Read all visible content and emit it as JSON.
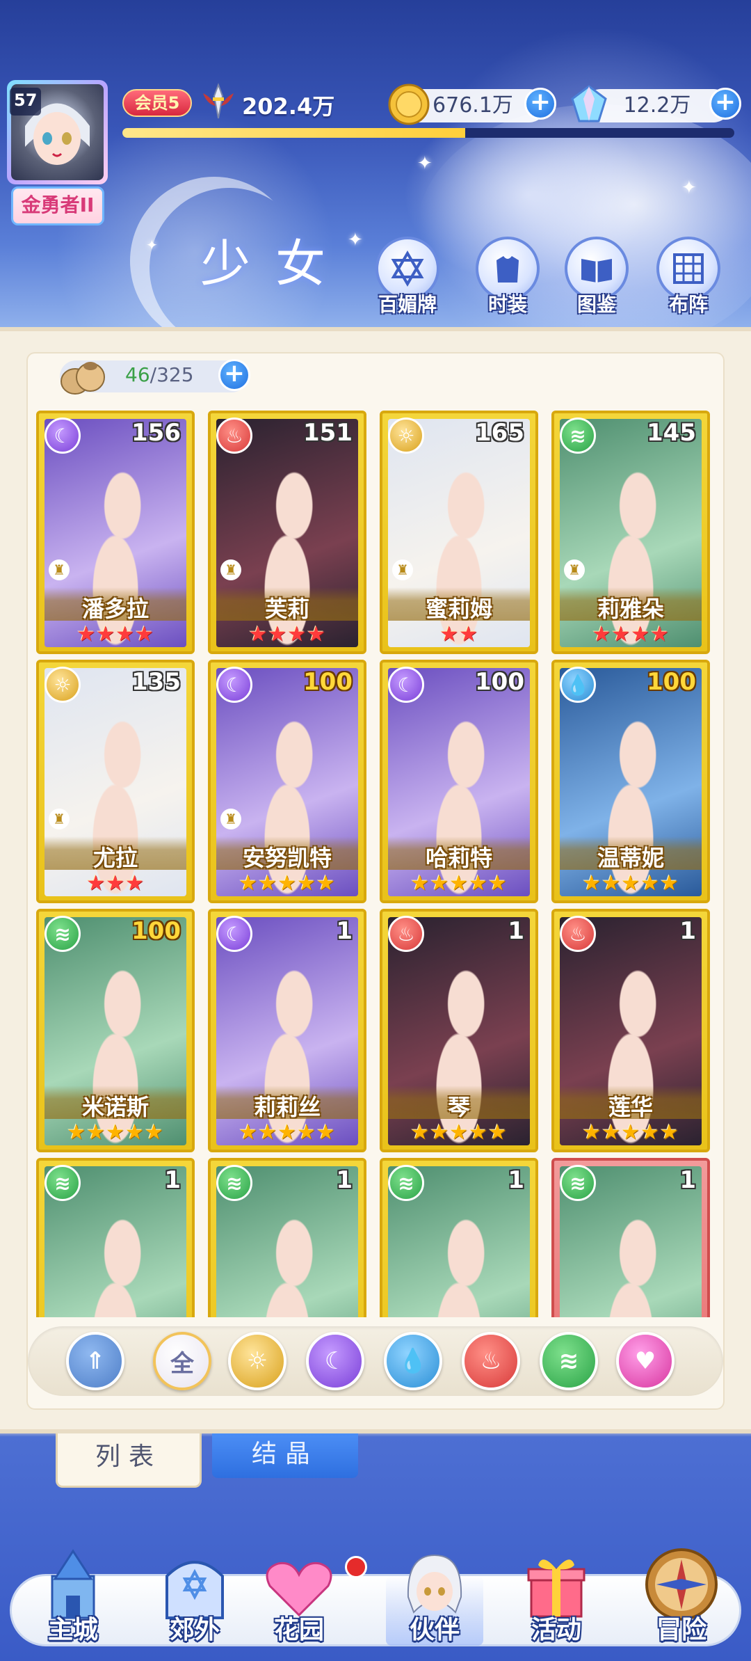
{
  "header": {
    "player_level": "57",
    "player_title": "金勇者II",
    "vip_label": "会员5",
    "power": "202.4万",
    "exp_progress": 0.56,
    "gold": "676.1万",
    "gems": "12.2万",
    "page_title": "少女",
    "actions": [
      {
        "label": "百媚牌",
        "icon": "star-of-david-icon"
      },
      {
        "label": "时装",
        "icon": "outfit-icon"
      },
      {
        "label": "图鉴",
        "icon": "book-icon"
      },
      {
        "label": "布阵",
        "icon": "grid-formation-icon"
      }
    ]
  },
  "bag": {
    "current": "46",
    "separator": "/",
    "max": "325"
  },
  "characters": [
    {
      "name": "潘多拉",
      "level": "156",
      "element": "moon",
      "stars": 4,
      "star_color": "red",
      "locked": true,
      "max": false
    },
    {
      "name": "芙莉",
      "level": "151",
      "element": "fire",
      "stars": 4,
      "star_color": "red",
      "locked": true,
      "max": false
    },
    {
      "name": "蜜莉姆",
      "level": "165",
      "element": "sun",
      "stars": 2,
      "star_color": "red",
      "locked": true,
      "max": false
    },
    {
      "name": "莉雅朵",
      "level": "145",
      "element": "wind",
      "stars": 4,
      "star_color": "red",
      "locked": true,
      "max": false
    },
    {
      "name": "尤拉",
      "level": "135",
      "element": "sun",
      "stars": 3,
      "star_color": "red",
      "locked": true,
      "max": false
    },
    {
      "name": "安努凯特",
      "level": "100",
      "element": "moon",
      "stars": 5,
      "star_color": "gold",
      "locked": true,
      "max": true
    },
    {
      "name": "哈莉特",
      "level": "100",
      "element": "moon",
      "stars": 5,
      "star_color": "gold",
      "locked": false,
      "max": false
    },
    {
      "name": "温蒂妮",
      "level": "100",
      "element": "water",
      "stars": 5,
      "star_color": "gold",
      "locked": false,
      "max": true
    },
    {
      "name": "米诺斯",
      "level": "100",
      "element": "wind",
      "stars": 5,
      "star_color": "gold",
      "locked": false,
      "max": true
    },
    {
      "name": "莉莉丝",
      "level": "1",
      "element": "moon",
      "stars": 5,
      "star_color": "gold",
      "locked": false,
      "max": false
    },
    {
      "name": "琴",
      "level": "1",
      "element": "fire",
      "stars": 5,
      "star_color": "gold",
      "locked": false,
      "max": false
    },
    {
      "name": "莲华",
      "level": "1",
      "element": "fire",
      "stars": 5,
      "star_color": "gold",
      "locked": false,
      "max": false
    },
    {
      "name": "",
      "level": "1",
      "element": "wind",
      "stars": 0,
      "star_color": "gold",
      "locked": false,
      "max": false
    },
    {
      "name": "",
      "level": "1",
      "element": "wind",
      "stars": 0,
      "star_color": "gold",
      "locked": false,
      "max": false
    },
    {
      "name": "",
      "level": "1",
      "element": "wind",
      "stars": 0,
      "star_color": "gold",
      "locked": false,
      "max": false
    },
    {
      "name": "",
      "level": "1",
      "element": "wind",
      "stars": 0,
      "star_color": "red",
      "locked": false,
      "max": false
    }
  ],
  "filters": [
    {
      "id": "sort",
      "label": ""
    },
    {
      "id": "all",
      "label": "全"
    },
    {
      "id": "sun",
      "label": ""
    },
    {
      "id": "moon",
      "label": ""
    },
    {
      "id": "water",
      "label": ""
    },
    {
      "id": "fire",
      "label": ""
    },
    {
      "id": "wind",
      "label": ""
    },
    {
      "id": "heart",
      "label": ""
    }
  ],
  "tabs": {
    "list": "列表",
    "crystal": "结晶"
  },
  "nav": [
    {
      "label": "主城",
      "icon": "castle-icon"
    },
    {
      "label": "郊外",
      "icon": "portal-icon"
    },
    {
      "label": "花园",
      "icon": "heart-garden-icon"
    },
    {
      "label": "伙伴",
      "icon": "partner-icon"
    },
    {
      "label": "活动",
      "icon": "gift-icon"
    },
    {
      "label": "冒险",
      "icon": "compass-icon"
    }
  ],
  "colors": {
    "card_gold": "#f4d63a",
    "card_red": "#e76c6c",
    "accent_blue": "#2e6fe0",
    "panel_bg": "#fbf7ee"
  }
}
